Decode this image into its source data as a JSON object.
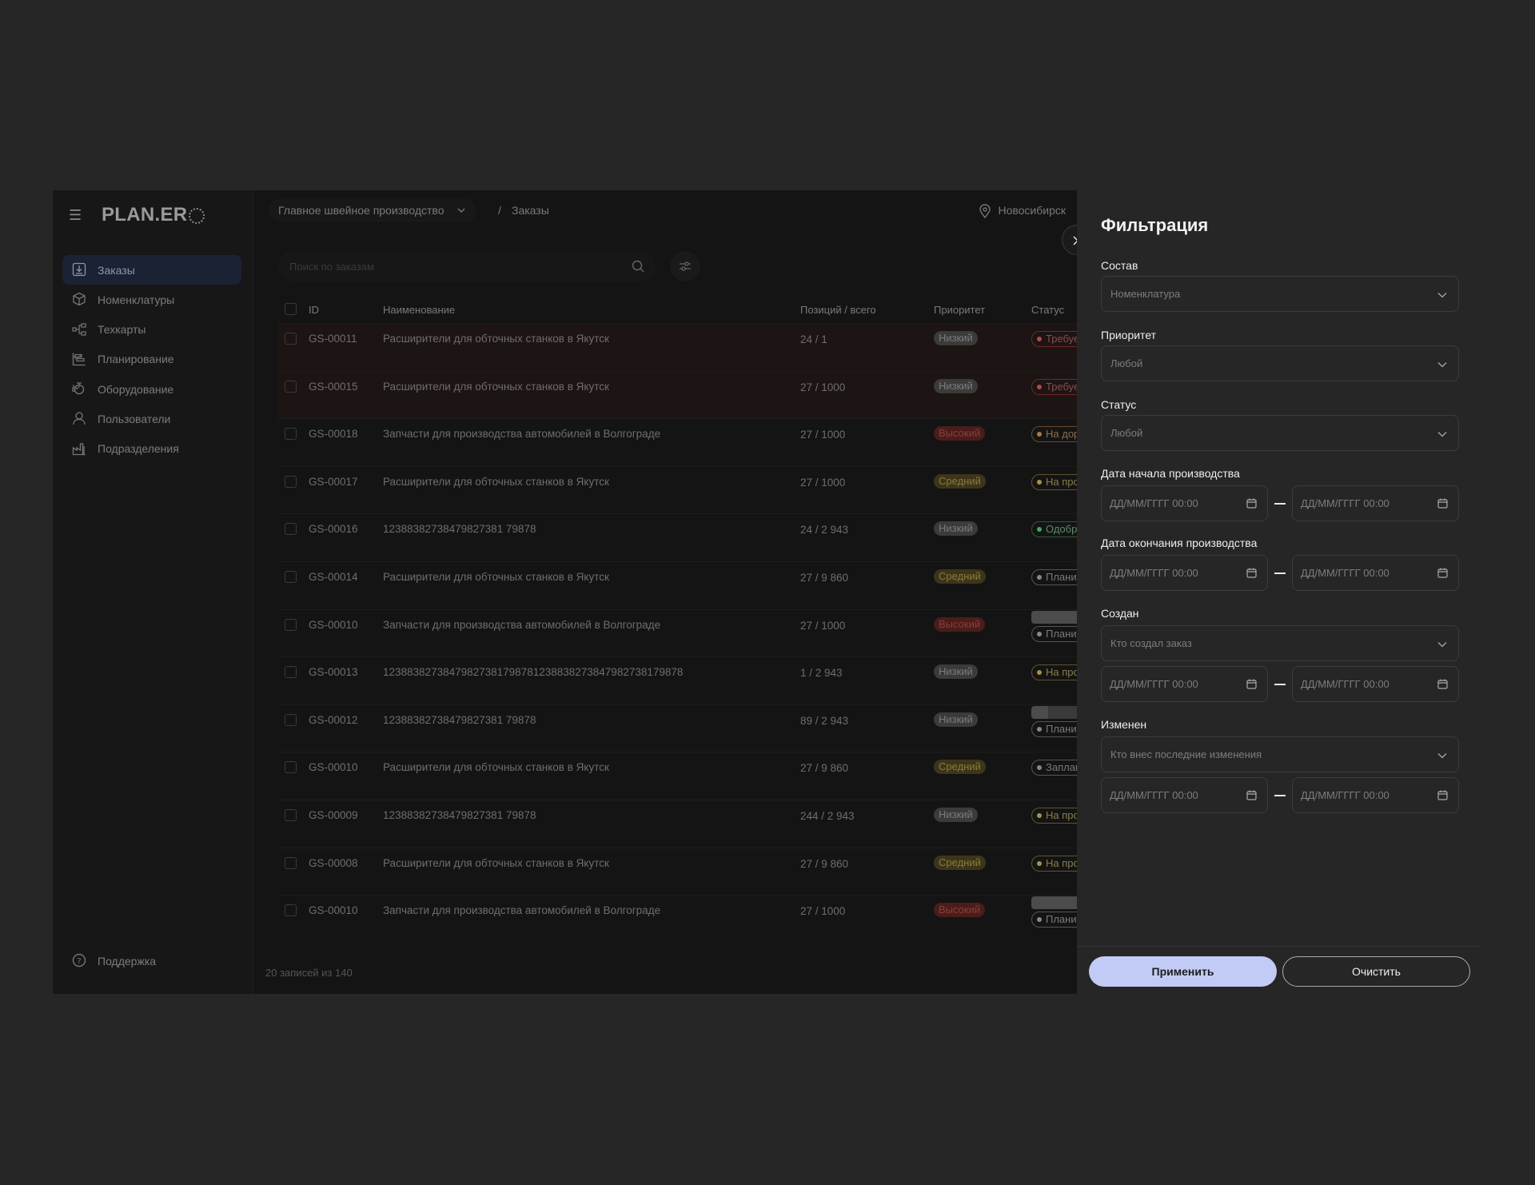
{
  "app": {
    "logo": "PLAN.ER",
    "sidebar": {
      "items": [
        {
          "label": "Заказы",
          "icon": "download-box-icon",
          "active": true
        },
        {
          "label": "Номенклатуры",
          "icon": "box-icon"
        },
        {
          "label": "Техкарты",
          "icon": "flowchart-icon"
        },
        {
          "label": "Планирование",
          "icon": "gantt-icon",
          "expandable": true
        },
        {
          "label": "Оборудование",
          "icon": "machine-icon",
          "expandable": true
        },
        {
          "label": "Пользователи",
          "icon": "user-icon"
        },
        {
          "label": "Подразделения",
          "icon": "factory-icon"
        }
      ],
      "support": "Поддержка"
    },
    "breadcrumb": {
      "workspace": "Главное швейное производство",
      "separator": "/",
      "current": "Заказы"
    },
    "location": "Новосибирск",
    "search": {
      "placeholder": "Поиск по заказам"
    },
    "table": {
      "headers": {
        "id": "ID",
        "name": "Наименование",
        "positions": "Позиций / всего",
        "priority": "Приоритет",
        "status": "Статус"
      },
      "rows": [
        {
          "id": "GS-00011",
          "name": "Расширители для обточных станков в Якутск",
          "positions": "24 / 1",
          "priority": "Низкий",
          "pri_class": "p-low",
          "status": "Требуется перепланирование",
          "st_class": "red",
          "highlight": true
        },
        {
          "id": "GS-00015",
          "name": "Расширители для обточных станков в Якутск",
          "positions": "27 / 1000",
          "priority": "Низкий",
          "pri_class": "p-low",
          "status": "Требуется перепланирование",
          "st_class": "red",
          "highlight": true
        },
        {
          "id": "GS-00018",
          "name": "Запчасти для производства автомобилей в Волгограде",
          "positions": "27 / 1000",
          "priority": "Высокий",
          "pri_class": "p-high",
          "status": "На доработку",
          "st_class": "orange"
        },
        {
          "id": "GS-00017",
          "name": "Расширители для обточных станков в Якутск",
          "positions": "27 / 1000",
          "priority": "Средний",
          "pri_class": "p-mid",
          "status": "На проверку",
          "st_class": "yellow"
        },
        {
          "id": "GS-00016",
          "name": "12388382738479827381 79878",
          "positions": "24 / 2 943",
          "priority": "Низкий",
          "pri_class": "p-low",
          "status": "Одобрен",
          "st_class": "green"
        },
        {
          "id": "GS-00014",
          "name": "Расширители для обточных станков в Якутск",
          "positions": "27 / 9 860",
          "priority": "Средний",
          "pri_class": "p-mid",
          "status": "Планирование производства",
          "st_class": "grey"
        },
        {
          "id": "GS-00010",
          "name": "Запчасти для производства автомобилей в Волгограде",
          "positions": "27 / 1000",
          "priority": "Высокий",
          "pri_class": "p-high",
          "status": "Планирование производства",
          "st_class": "grey",
          "progress": "56%",
          "progress_value": 56,
          "progress_blue": false
        },
        {
          "id": "GS-00013",
          "name": "12388382738479827381798781238838273847982738179878",
          "positions": "1 / 2 943",
          "priority": "Низкий",
          "pri_class": "p-low",
          "status": "На проверку",
          "st_class": "yellow"
        },
        {
          "id": "GS-00012",
          "name": "12388382738479827381 79878",
          "positions": "89 / 2 943",
          "priority": "Низкий",
          "pri_class": "p-low",
          "status": "Планирование производства",
          "st_class": "grey",
          "progress": "16%",
          "progress_value": 16,
          "progress_blue": true
        },
        {
          "id": "GS-00010",
          "name": "Расширители для обточных станков в Якутск",
          "positions": "27 / 9 860",
          "priority": "Средний",
          "pri_class": "p-mid",
          "status": "Запланирован",
          "st_class": "grey"
        },
        {
          "id": "GS-00009",
          "name": "12388382738479827381 79878",
          "positions": "244 / 2 943",
          "priority": "Низкий",
          "pri_class": "p-low",
          "status": "На проверку",
          "st_class": "yellow"
        },
        {
          "id": "GS-00008",
          "name": "Расширители для обточных станков в Якутск",
          "positions": "27 / 9 860",
          "priority": "Средний",
          "pri_class": "p-mid",
          "status": "На проверку",
          "st_class": "yellow"
        },
        {
          "id": "GS-00010",
          "name": "Запчасти для производства автомобилей в Волгограде",
          "positions": "27 / 1000",
          "priority": "Высокий",
          "pri_class": "p-high",
          "status": "Планирование производства",
          "st_class": "grey",
          "progress": "56%",
          "progress_value": 56,
          "progress_blue": false
        }
      ],
      "footer": "20 записей из 140"
    }
  },
  "filter_panel": {
    "title": "Фильтрация",
    "composition": {
      "label": "Состав",
      "placeholder": "Номенклатура"
    },
    "priority": {
      "label": "Приоритет",
      "value": "Любой"
    },
    "status": {
      "label": "Статус",
      "value": "Любой"
    },
    "start_date": {
      "label": "Дата начала производства",
      "from": "ДД/ММ/ГГГГ 00:00",
      "to": "ДД/ММ/ГГГГ 00:00"
    },
    "end_date": {
      "label": "Дата окончания производства",
      "from": "ДД/ММ/ГГГГ 00:00",
      "to": "ДД/ММ/ГГГГ 00:00"
    },
    "created": {
      "label": "Создан",
      "placeholder": "Кто создал заказ",
      "from": "ДД/ММ/ГГГГ 00:00",
      "to": "ДД/ММ/ГГГГ 00:00"
    },
    "modified": {
      "label": "Изменен",
      "placeholder": "Кто внес последние изменения",
      "from": "ДД/ММ/ГГГГ 00:00",
      "to": "ДД/ММ/ГГГГ 00:00"
    },
    "apply": "Применить",
    "clear": "Очистить"
  }
}
